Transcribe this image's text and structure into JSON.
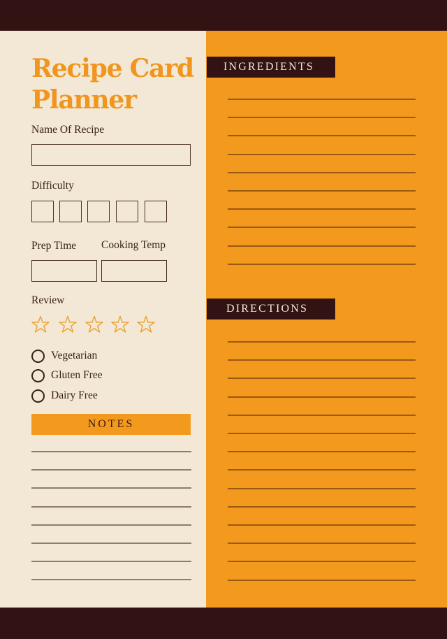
{
  "colors": {
    "dark_brown": "#321212",
    "cream": "#F2E8D5",
    "orange": "#F39A1E",
    "star_outline": "#EBA53A"
  },
  "left": {
    "title_line1": "Recipe Card",
    "title_line2": "Planner",
    "name_label": "Name Of Recipe",
    "name_value": "",
    "difficulty_label": "Difficulty",
    "difficulty_boxes": 5,
    "prep_time_label": "Prep Time",
    "prep_time_value": "",
    "cooking_temp_label": "Cooking Temp",
    "cooking_temp_value": "",
    "review_label": "Review",
    "review_rating": 0,
    "review_max": 5,
    "dietary_options": [
      {
        "label": "Vegetarian",
        "checked": false
      },
      {
        "label": "Gluten Free",
        "checked": false
      },
      {
        "label": "Dairy Free",
        "checked": false
      }
    ],
    "notes_header": "NOTES",
    "notes_line_count": 8
  },
  "right": {
    "ingredients_header": "INGREDIENTS",
    "ingredients_line_count": 10,
    "directions_header": "DIRECTIONS",
    "directions_line_count": 14
  },
  "icons": {
    "star": "star-outline-icon",
    "radio": "circle-outline-icon"
  }
}
